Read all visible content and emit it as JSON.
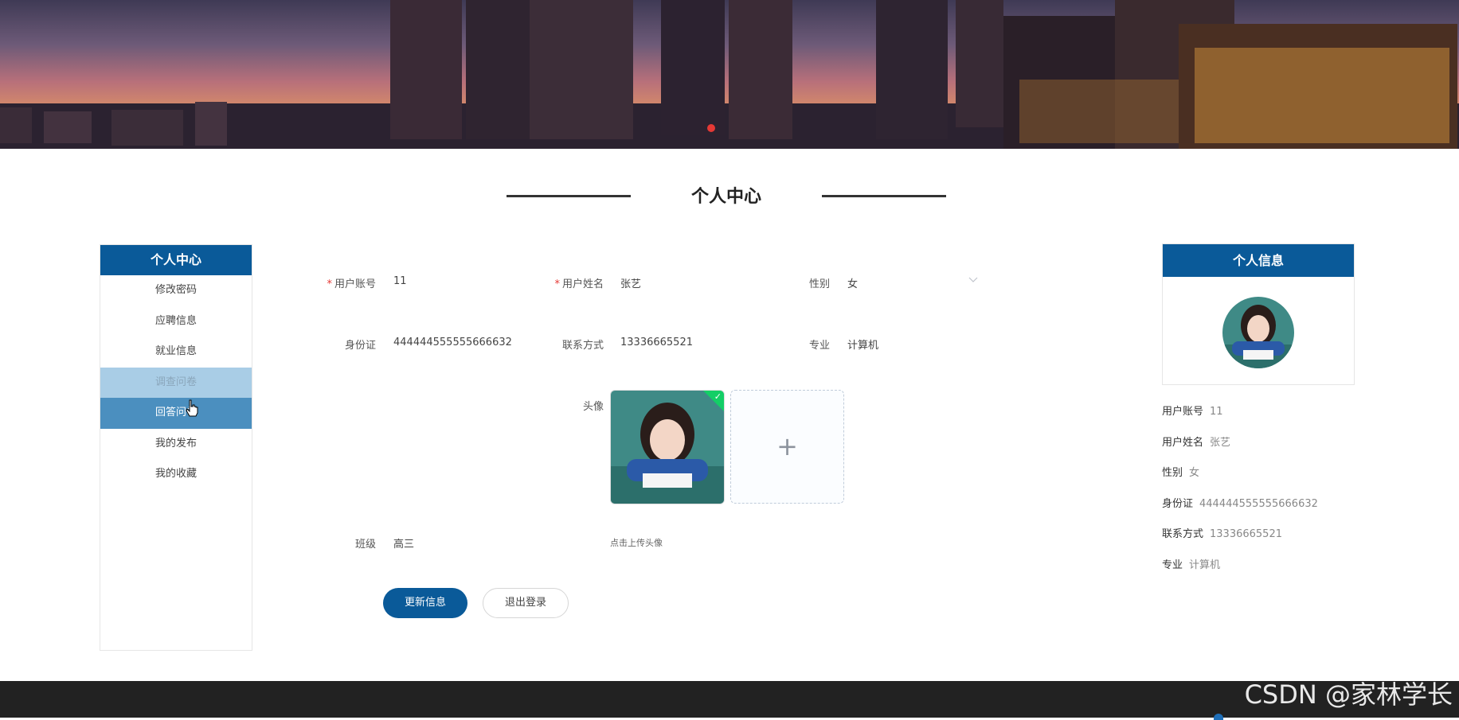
{
  "section_title": "个人中心",
  "sidebar": {
    "header": "个人中心",
    "items": [
      {
        "label": "修改密码"
      },
      {
        "label": "应聘信息"
      },
      {
        "label": "就业信息"
      },
      {
        "label": "调查问卷"
      },
      {
        "label": "回答问卷"
      },
      {
        "label": "我的发布"
      },
      {
        "label": "我的收藏"
      }
    ]
  },
  "form": {
    "account_label": "用户账号",
    "account_value": "11",
    "name_label": "用户姓名",
    "name_value": "张艺",
    "gender_label": "性别",
    "gender_value": "女",
    "id_label": "身份证",
    "id_value": "444444555555666632",
    "phone_label": "联系方式",
    "phone_value": "13336665521",
    "major_label": "专业",
    "major_value": "计算机",
    "avatar_label": "头像",
    "upload_hint": "点击上传头像",
    "class_label": "班级",
    "class_value": "高三",
    "update_button": "更新信息",
    "logout_button": "退出登录"
  },
  "info_panel": {
    "header": "个人信息",
    "rows": [
      {
        "key": "用户账号",
        "value": "11"
      },
      {
        "key": "用户姓名",
        "value": "张艺"
      },
      {
        "key": "性别",
        "value": "女"
      },
      {
        "key": "身份证",
        "value": "444444555555666632"
      },
      {
        "key": "联系方式",
        "value": "13336665521"
      },
      {
        "key": "专业",
        "value": "计算机"
      }
    ]
  },
  "watermark": "CSDN @家林学长",
  "colors": {
    "primary": "#0a5a99",
    "sidebar_hover": "#a9cde6",
    "sidebar_active": "#4b8fbf",
    "required": "#e53935",
    "upload_success": "#13ce66"
  }
}
